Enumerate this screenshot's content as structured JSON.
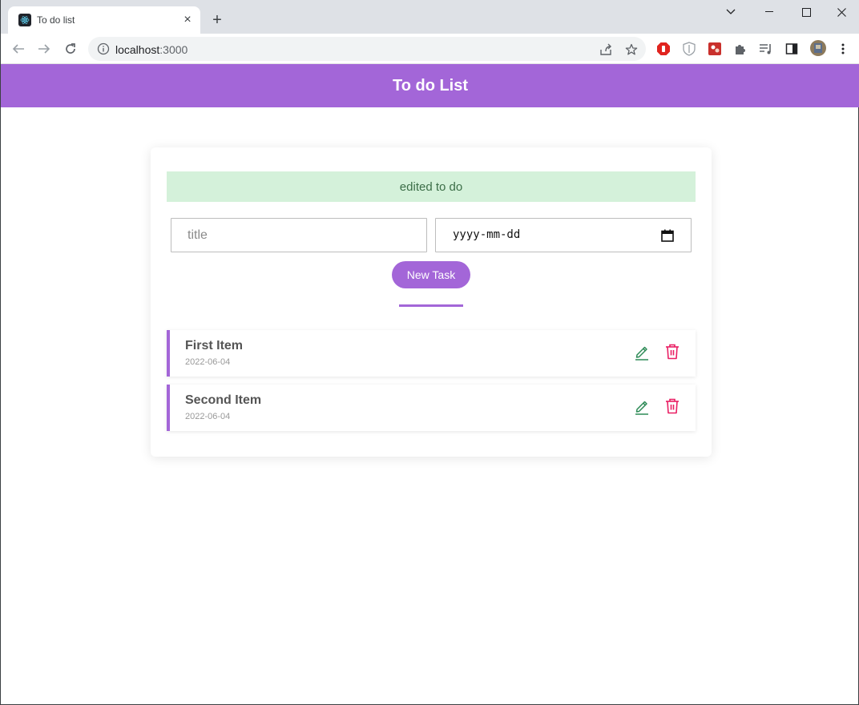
{
  "browser": {
    "tab_title": "To do list",
    "tab_close": "×",
    "new_tab": "+",
    "url_host": "localhost",
    "url_port": ":3000"
  },
  "app": {
    "header_title": "To do List",
    "alert_text": "edited to do",
    "form": {
      "title_placeholder": "title",
      "date_placeholder": "yyyy-mm-dd",
      "submit_label": "New Task"
    },
    "todos": [
      {
        "title": "First Item",
        "date": "2022-06-04"
      },
      {
        "title": "Second Item",
        "date": "2022-06-04"
      }
    ]
  },
  "colors": {
    "accent": "#a366d8",
    "alert_bg": "#d4f1da",
    "alert_text": "#3c6e48",
    "edit_icon": "#2e8b57",
    "delete_icon": "#e91e63"
  }
}
